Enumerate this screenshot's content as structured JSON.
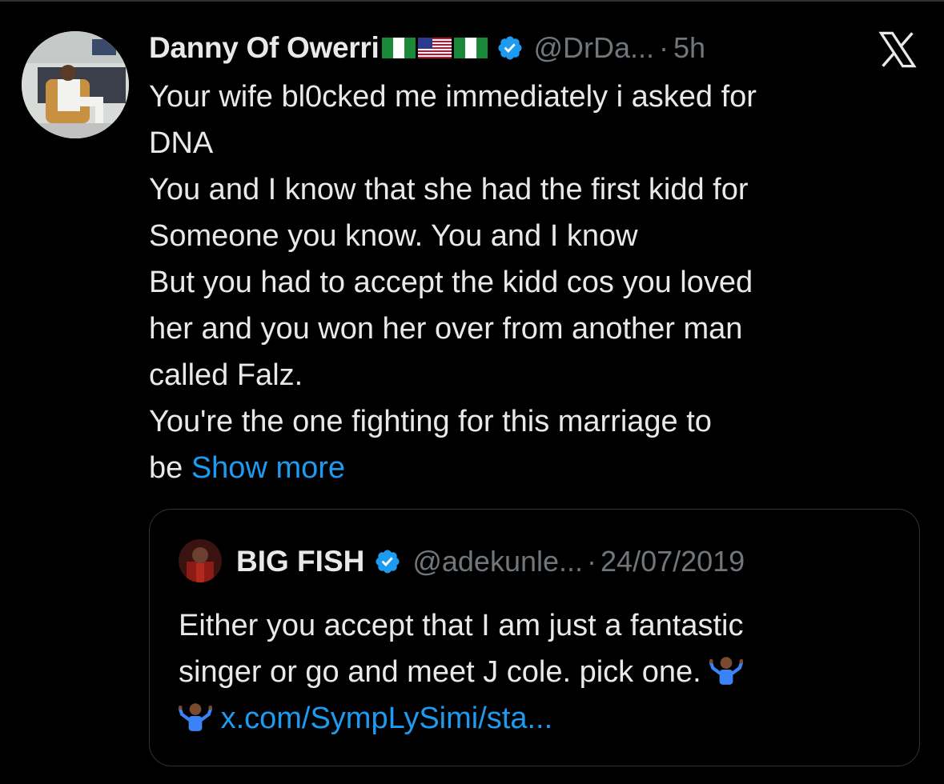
{
  "tweet": {
    "author_name": "Danny Of Owerri",
    "author_handle": "@DrDa...",
    "separator": "·",
    "time": "5h",
    "body_lines": [
      "Your wife bl0cked me immediately i asked for",
      "DNA",
      "You and I know that she had the first kidd for",
      "Someone you know. You and I know",
      "But you had to accept the kidd cos you loved",
      "her and you won her over from another man",
      "called Falz.",
      "You're the one fighting for this marriage to"
    ],
    "last_line_start": "be ",
    "show_more": "Show more",
    "flags": [
      "nigeria-flag",
      "usa-flag",
      "nigeria-flag"
    ]
  },
  "quoted": {
    "author_name": "BIG FISH",
    "author_handle": "@adekunle...",
    "separator": "·",
    "date": "24/07/2019",
    "line1": "Either you accept that I am just a fantastic",
    "line2": "singer or go and meet J cole. pick one.",
    "link": "x.com/SympLySimi/sta..."
  },
  "icons": {
    "logo": "x-logo-icon",
    "verified": "verified-badge-icon",
    "emoji": "person-shrugging-emoji"
  },
  "colors": {
    "background": "#000000",
    "text": "#e7e9ea",
    "secondary": "#71767b",
    "accent": "#1d9bf0",
    "border": "#2f3336"
  }
}
